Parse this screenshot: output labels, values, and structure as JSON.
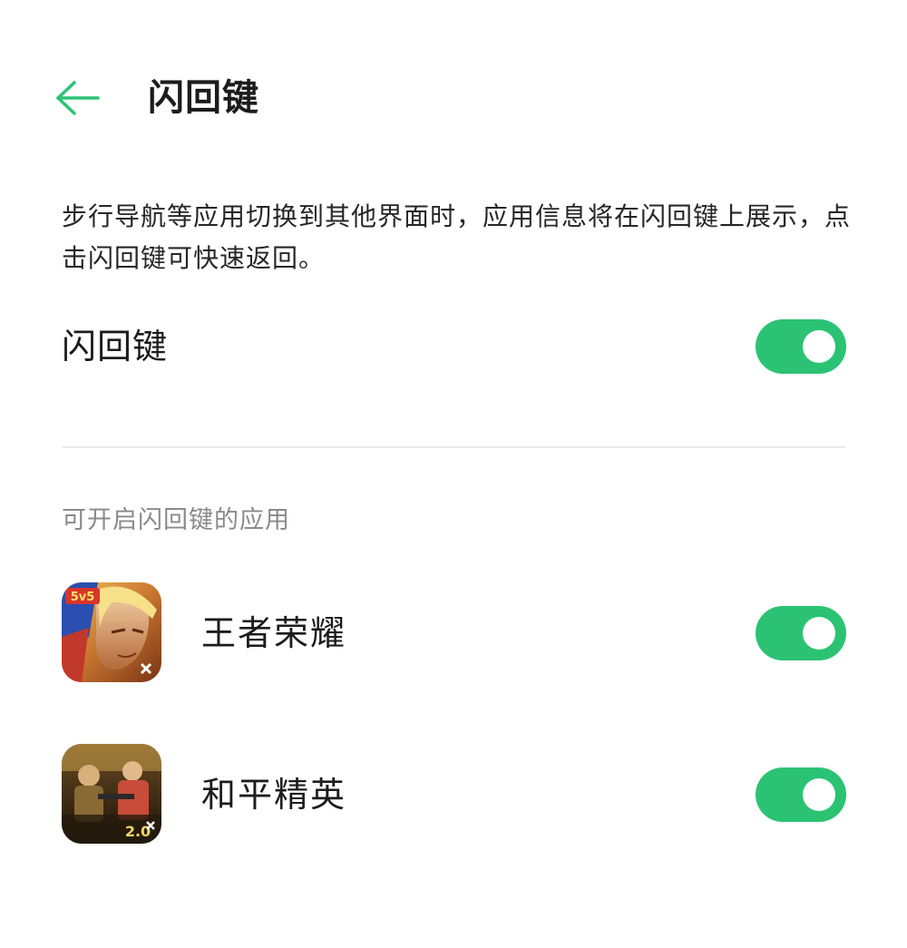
{
  "header": {
    "title": "闪回键",
    "back_icon": "arrow-left-icon",
    "accent_color": "#2bc373"
  },
  "description": "步行导航等应用切换到其他界面时，应用信息将在闪回键上展示，点击闪回键可快速返回。",
  "main_setting": {
    "label": "闪回键",
    "enabled": true
  },
  "section": {
    "header": "可开启闪回键的应用"
  },
  "apps": [
    {
      "name": "王者荣耀",
      "icon": "honor-of-kings-app-icon",
      "enabled": true
    },
    {
      "name": "和平精英",
      "icon": "game-for-peace-app-icon",
      "enabled": true
    }
  ],
  "colors": {
    "toggle_on": "#2bc373",
    "section_header": "#8a8a8a",
    "divider": "#ececec"
  }
}
